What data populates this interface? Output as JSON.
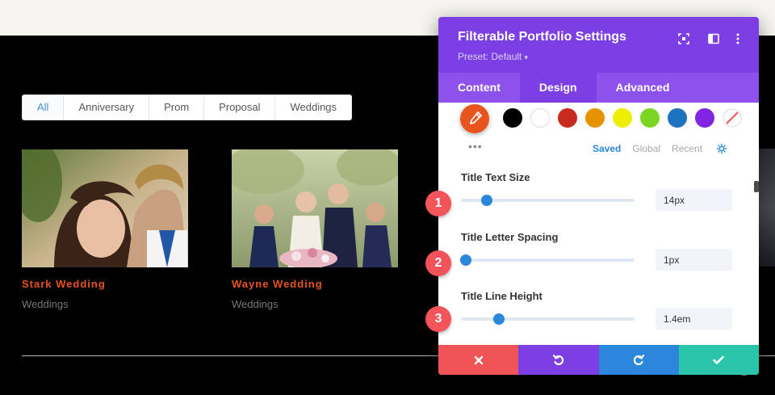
{
  "filters": [
    "All",
    "Anniversary",
    "Prom",
    "Proposal",
    "Weddings"
  ],
  "active_filter_index": 0,
  "cards": [
    {
      "title": "Stark Wedding",
      "category": "Weddings"
    },
    {
      "title": "Wayne Wedding",
      "category": "Weddings"
    }
  ],
  "pagination": {
    "visible_page": "2"
  },
  "panel": {
    "title": "Filterable Portfolio Settings",
    "preset_label": "Preset: Default",
    "tabs": [
      "Content",
      "Design",
      "Advanced"
    ],
    "active_tab_index": 1,
    "header_icons": [
      "focus-icon",
      "columns-icon",
      "more-vertical-icon"
    ],
    "color_picker": {
      "selected_color": "#e8541d",
      "swatches": [
        "#000000",
        "#ffffff",
        "#c92a1e",
        "#e59400",
        "#eeee00",
        "#7cd621",
        "#1e73be",
        "#8224e3"
      ],
      "swatch_names": [
        "black",
        "white",
        "red",
        "orange",
        "yellow",
        "green",
        "blue",
        "purple"
      ],
      "more_label": "•••",
      "tabs": [
        "Saved",
        "Global",
        "Recent"
      ],
      "active_tab_index": 0
    },
    "fields": [
      {
        "label": "Title Text Size",
        "value": "14px",
        "slider_fraction": 0.15
      },
      {
        "label": "Title Letter Spacing",
        "value": "1px",
        "slider_fraction": 0.03
      },
      {
        "label": "Title Line Height",
        "value": "1.4em",
        "slider_fraction": 0.22
      }
    ],
    "footer_buttons": [
      {
        "name": "discard",
        "color": "#ef5556"
      },
      {
        "name": "undo",
        "color": "#7b3fe4"
      },
      {
        "name": "redo",
        "color": "#2b87da"
      },
      {
        "name": "save",
        "color": "#29c4a9"
      }
    ]
  },
  "step_badges": [
    "1",
    "2",
    "3"
  ],
  "colors": {
    "accent_title": "#e8541d",
    "active_filter": "#4a8fd6",
    "panel_header": "#7b3fe4",
    "panel_tabs": "#8e52ec",
    "slider": "#2b87da",
    "badge": "#f3545a"
  }
}
